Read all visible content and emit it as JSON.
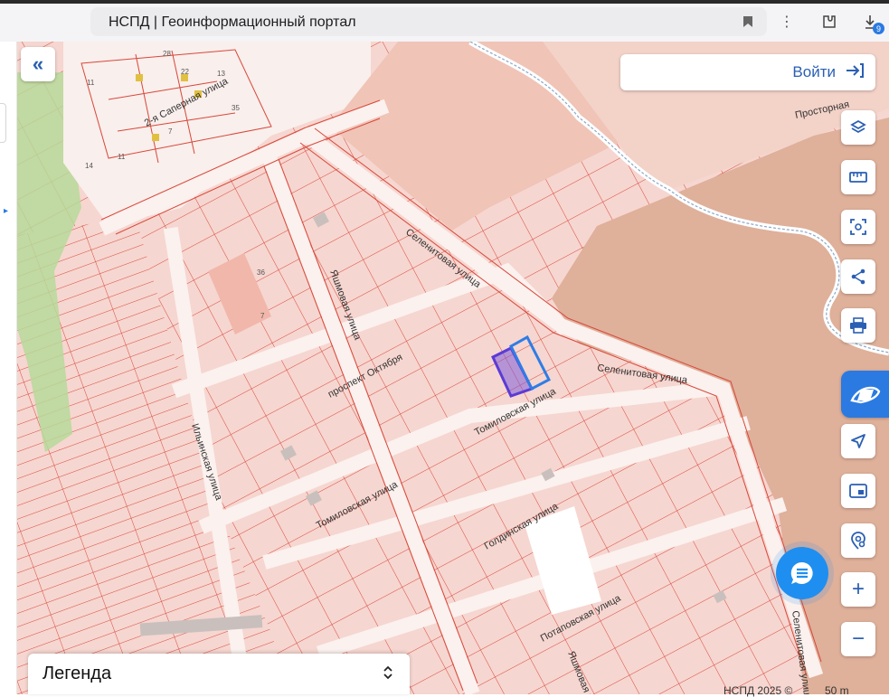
{
  "browser": {
    "title": "НСПД | Геоинформационный портал",
    "bookmark_icon": "bookmark-icon",
    "menu_icon": "more-vert-icon",
    "extension_icon": "extension-icon",
    "downloads_icon": "download-icon",
    "downloads_count": "9"
  },
  "header": {
    "collapse_icon": "double-chevron-left-icon",
    "login_label": "Войти",
    "login_icon": "login-arrow-icon"
  },
  "tools": [
    {
      "name": "layers",
      "icon": "layers-icon"
    },
    {
      "name": "ruler",
      "icon": "ruler-icon"
    },
    {
      "name": "select-area",
      "icon": "select-area-icon"
    },
    {
      "name": "share",
      "icon": "share-icon"
    },
    {
      "name": "print",
      "icon": "print-icon"
    },
    {
      "name": "active-tool",
      "icon": "hand-search-icon"
    },
    {
      "name": "locate",
      "icon": "navigation-arrow-icon"
    },
    {
      "name": "picture-in-picture",
      "icon": "pip-icon"
    },
    {
      "name": "geo-search",
      "icon": "location-search-icon"
    },
    {
      "name": "zoom-in",
      "icon": "plus-icon",
      "label": "+"
    },
    {
      "name": "zoom-out",
      "icon": "minus-icon",
      "label": "−"
    }
  ],
  "chat": {
    "icon": "chat-icon"
  },
  "legend": {
    "label": "Легенда",
    "icon": "chevron-updown-icon"
  },
  "footer": {
    "copyright": "НСПД 2025 ©",
    "scale": "50 m"
  },
  "map": {
    "streets": [
      "2-я Саперная улица",
      "Селенитовая улица",
      "Селенитовая улица",
      "Яшмовая улица",
      "проспект Октября",
      "Томиловская улица",
      "Ильинская улица",
      "Томиловская улица",
      "Голдинская улица",
      "Потаповская улица",
      "Яшмовая улица",
      "Селенитовая улица",
      "Просторная"
    ],
    "house_numbers": [
      "28",
      "11",
      "22",
      "13",
      "35",
      "11",
      "7",
      "14",
      "36",
      "7"
    ],
    "colors": {
      "parcel_fill": "#f6d6d0",
      "parcel_stroke": "#d8473a",
      "road": "#f7ece9",
      "large_zone": "#f0c4b6",
      "brown_zone": "#dfb09a",
      "green_zone": "#b7d99a",
      "highlight_purple": "#5b3bd6",
      "highlight_blue": "#2f7de6"
    }
  }
}
